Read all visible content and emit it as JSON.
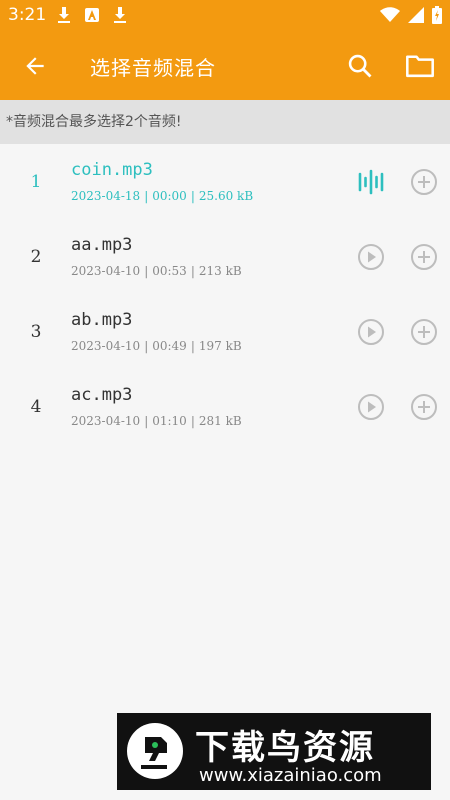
{
  "status_bar": {
    "time": "3:21",
    "left_icons": [
      "download-icon",
      "a-app-icon",
      "download-icon"
    ],
    "right_icons": [
      "wifi-icon",
      "signal-icon",
      "battery-icon"
    ]
  },
  "app_bar": {
    "title": "选择音频混合",
    "color": "#f39a10"
  },
  "notice": "*音频混合最多选择2个音频!",
  "files": [
    {
      "index": "1",
      "name": "coin.mp3",
      "date": "2023-04-18",
      "duration": "00:00",
      "size": "25.60 kB",
      "active": true
    },
    {
      "index": "2",
      "name": "aa.mp3",
      "date": "2023-04-10",
      "duration": "00:53",
      "size": "213 kB",
      "active": false
    },
    {
      "index": "3",
      "name": "ab.mp3",
      "date": "2023-04-10",
      "duration": "00:49",
      "size": "197 kB",
      "active": false
    },
    {
      "index": "4",
      "name": "ac.mp3",
      "date": "2023-04-10",
      "duration": "01:10",
      "size": "281 kB",
      "active": false
    }
  ],
  "colors": {
    "accent": "#2dbfbf",
    "icon_gray": "#bdbdbd"
  },
  "watermark": {
    "title": "下载鸟资源",
    "url": "www.xiazainiao.com"
  }
}
